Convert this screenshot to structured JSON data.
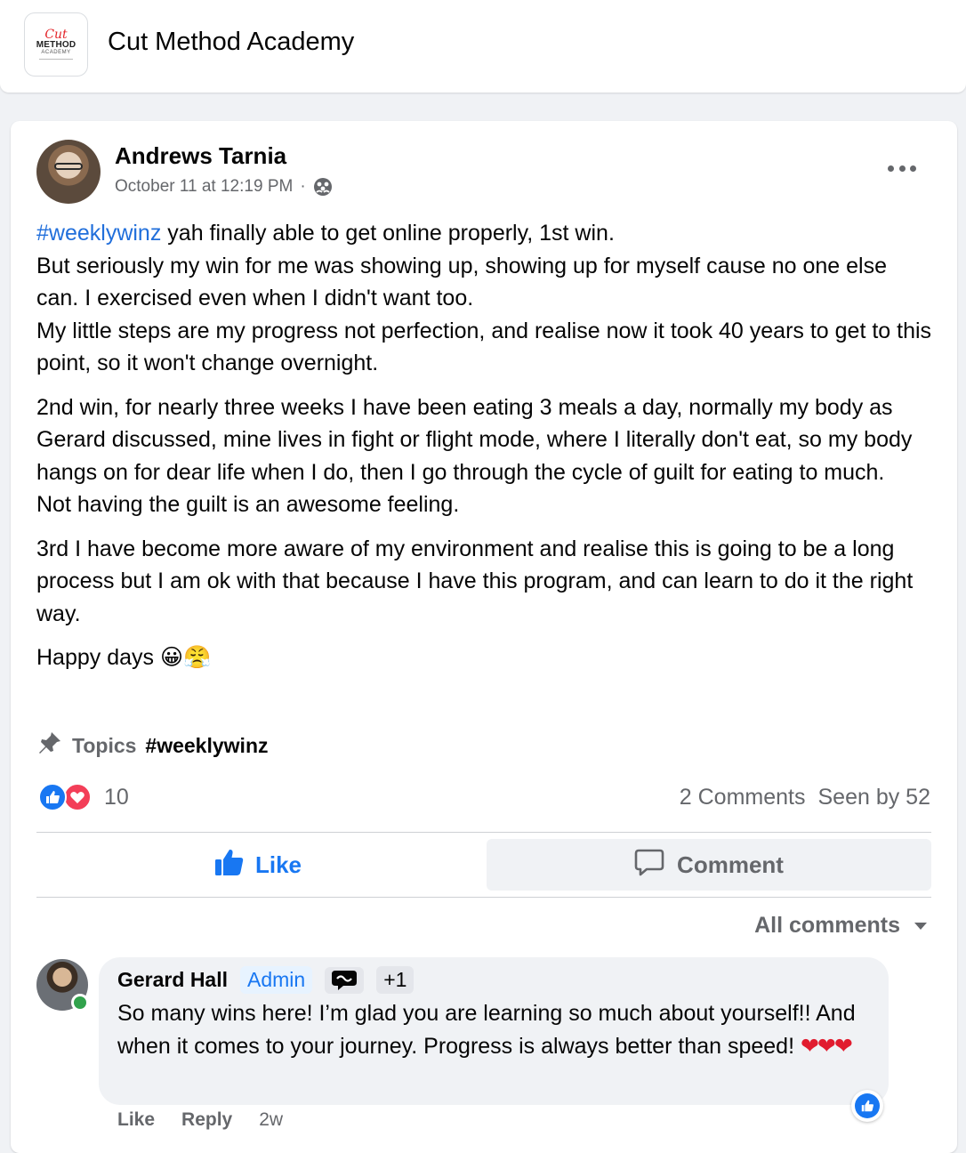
{
  "group": {
    "name": "Cut Method Academy",
    "logo": {
      "line1": "Cut",
      "line2": "METHOD",
      "line3": "ACADEMY"
    }
  },
  "post": {
    "author": "Andrews Tarnia",
    "timestamp": "October 11 at 12:19 PM",
    "separator": "·",
    "audience_icon": "group-audience-icon",
    "paragraphs": {
      "p1": {
        "hashtag": "#weeklywinz",
        "line1_rest": " yah finally able to get online properly, 1st win.",
        "line2": "But seriously my win for me was showing up, showing up for myself cause no one else can. I exercised even when I didn't want too.",
        "line3": "My little steps are my progress not perfection, and realise now it took 40 years to get to this point, so it won't change overnight."
      },
      "p2": {
        "line1": "2nd win, for nearly three weeks I have been  eating 3 meals a day, normally my body as Gerard discussed, mine lives in fight or flight mode, where I literally don't eat, so my body hangs on for dear life when I do, then I go through the cycle of guilt for eating to much.",
        "line2": "Not having the guilt is an awesome feeling."
      },
      "p3": "3rd I have become more aware of my environment and realise this is going to be a long process but I am ok with that because I have this program, and can learn to do it the right way.",
      "p4_text": "Happy days ",
      "p4_emoji": "😀😤"
    },
    "topics": {
      "label": "Topics",
      "tag": "#weeklywinz"
    },
    "reactions": {
      "count": "10"
    },
    "stats": {
      "comments": "2 Comments",
      "seen": "Seen by 52"
    },
    "actions": {
      "like": "Like",
      "comment": "Comment"
    }
  },
  "comments_section": {
    "filter_label": "All comments",
    "comment": {
      "author": "Gerard Hall",
      "badge_admin": "Admin",
      "badge_plus": "+1",
      "text": "So many wins here! I’m glad you are learning so much about yourself!! And when it comes to your journey. Progress is always better than speed! ",
      "hearts": "❤❤❤",
      "like_label": "Like",
      "reply_label": "Reply",
      "age": "2w"
    }
  },
  "colors": {
    "accent": "#1877f2",
    "hashtag": "#216fdb",
    "secondary_text": "#65676b",
    "love": "#f33e58",
    "online": "#31a24c"
  }
}
